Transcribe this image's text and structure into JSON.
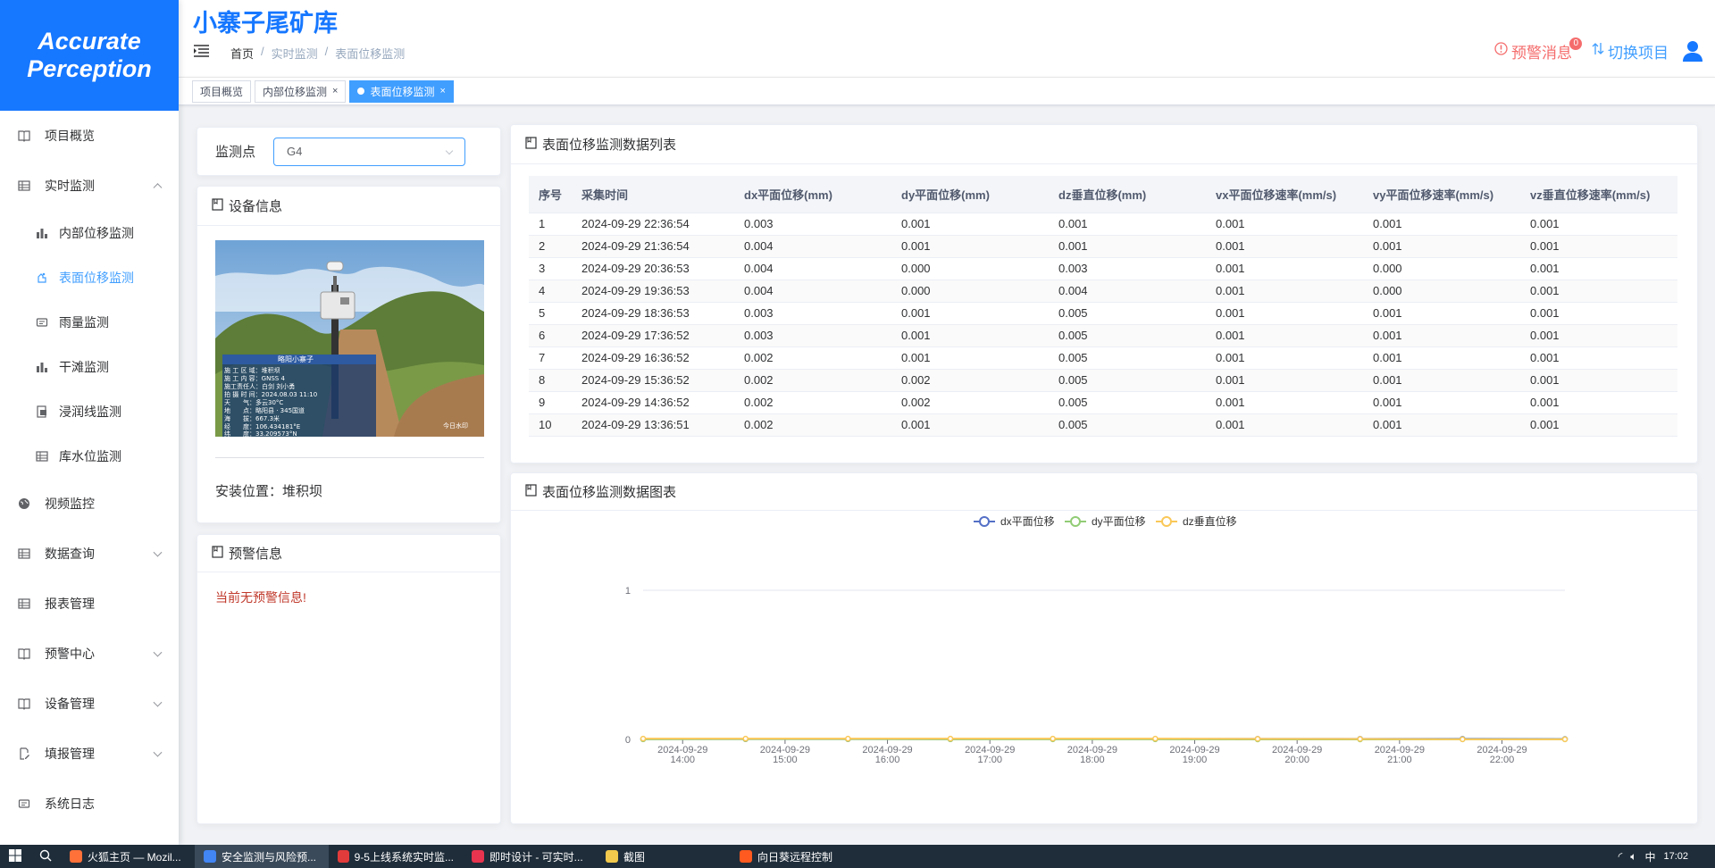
{
  "logo": {
    "line1": "Accurate",
    "line2": "Perception"
  },
  "header": {
    "project_title": "小寨子尾矿库",
    "breadcrumb": [
      "首页",
      "实时监测",
      "表面位移监测"
    ],
    "warning_label": "预警消息",
    "warning_count": "0",
    "switch_label": "切换项目"
  },
  "sidebar": {
    "items": [
      {
        "label": "项目概览",
        "icon": "book-icon"
      },
      {
        "label": "实时监测",
        "icon": "grid-icon"
      },
      {
        "label": "视频监控",
        "icon": "globe-icon"
      },
      {
        "label": "数据查询",
        "icon": "grid-icon"
      },
      {
        "label": "报表管理",
        "icon": "grid-icon"
      },
      {
        "label": "预警中心",
        "icon": "book-icon"
      },
      {
        "label": "设备管理",
        "icon": "book-icon"
      },
      {
        "label": "填报管理",
        "icon": "form-icon"
      },
      {
        "label": "系统日志",
        "icon": "log-icon"
      }
    ],
    "sub_items": [
      {
        "label": "内部位移监测",
        "icon": "bar-chart-icon"
      },
      {
        "label": "表面位移监测",
        "icon": "surface-icon"
      },
      {
        "label": "雨量监测",
        "icon": "rain-icon"
      },
      {
        "label": "干滩监测",
        "icon": "bar-chart-icon"
      },
      {
        "label": "浸润线监测",
        "icon": "doc-icon"
      },
      {
        "label": "库水位监测",
        "icon": "grid-icon"
      }
    ]
  },
  "tags": [
    {
      "label": "项目概览",
      "closable": false
    },
    {
      "label": "内部位移监测",
      "closable": true
    },
    {
      "label": "表面位移监测",
      "closable": true,
      "active": true
    }
  ],
  "monitor": {
    "label": "监测点",
    "selected": "G4"
  },
  "device": {
    "title": "设备信息",
    "install_label": "安装位置：",
    "install_value": "堆积坝",
    "photo_overlay": {
      "header": "略阳小寨子",
      "lines": [
        "施 工 区 域：堆积坝",
        "施 工 内 容：GNSS 4",
        "施工责任人：白剑 刘小勇",
        "拍 摄 时 间：2024.08.03 11:10",
        "天　　气：多云30°C",
        "地　　点：略阳县 · 345国道",
        "海　　拔：667.3米",
        "经　　度：106.434181°E",
        "纬　　度：33.209573°N"
      ],
      "watermark": "今日水印"
    }
  },
  "warning_info": {
    "title": "预警信息",
    "message": "当前无预警信息!"
  },
  "table": {
    "title": "表面位移监测数据列表",
    "columns": [
      "序号",
      "采集时间",
      "dx平面位移(mm)",
      "dy平面位移(mm)",
      "dz垂直位移(mm)",
      "vx平面位移速率(mm/s)",
      "vy平面位移速率(mm/s)",
      "vz垂直位移速率(mm/s)"
    ],
    "rows": [
      [
        "1",
        "2024-09-29 22:36:54",
        "0.003",
        "0.001",
        "0.001",
        "0.001",
        "0.001",
        "0.001"
      ],
      [
        "2",
        "2024-09-29 21:36:54",
        "0.004",
        "0.001",
        "0.001",
        "0.001",
        "0.001",
        "0.001"
      ],
      [
        "3",
        "2024-09-29 20:36:53",
        "0.004",
        "0.000",
        "0.003",
        "0.001",
        "0.000",
        "0.001"
      ],
      [
        "4",
        "2024-09-29 19:36:53",
        "0.004",
        "0.000",
        "0.004",
        "0.001",
        "0.000",
        "0.001"
      ],
      [
        "5",
        "2024-09-29 18:36:53",
        "0.003",
        "0.001",
        "0.005",
        "0.001",
        "0.001",
        "0.001"
      ],
      [
        "6",
        "2024-09-29 17:36:52",
        "0.003",
        "0.001",
        "0.005",
        "0.001",
        "0.001",
        "0.001"
      ],
      [
        "7",
        "2024-09-29 16:36:52",
        "0.002",
        "0.001",
        "0.005",
        "0.001",
        "0.001",
        "0.001"
      ],
      [
        "8",
        "2024-09-29 15:36:52",
        "0.002",
        "0.002",
        "0.005",
        "0.001",
        "0.001",
        "0.001"
      ],
      [
        "9",
        "2024-09-29 14:36:52",
        "0.002",
        "0.002",
        "0.005",
        "0.001",
        "0.001",
        "0.001"
      ],
      [
        "10",
        "2024-09-29 13:36:51",
        "0.002",
        "0.001",
        "0.005",
        "0.001",
        "0.001",
        "0.001"
      ]
    ]
  },
  "chart_title": "表面位移监测数据图表",
  "chart_data": {
    "type": "line",
    "x": [
      "2024-09-29 13:36:51",
      "2024-09-29 14:36:52",
      "2024-09-29 15:36:52",
      "2024-09-29 16:36:52",
      "2024-09-29 17:36:52",
      "2024-09-29 18:36:53",
      "2024-09-29 19:36:53",
      "2024-09-29 20:36:53",
      "2024-09-29 21:36:54",
      "2024-09-29 22:36:54"
    ],
    "x_ticks": [
      {
        "t": "2024-09-29 14:00",
        "l1": "2024-09-29",
        "l2": "14:00"
      },
      {
        "t": "2024-09-29 15:00",
        "l1": "2024-09-29",
        "l2": "15:00"
      },
      {
        "t": "2024-09-29 16:00",
        "l1": "2024-09-29",
        "l2": "16:00"
      },
      {
        "t": "2024-09-29 17:00",
        "l1": "2024-09-29",
        "l2": "17:00"
      },
      {
        "t": "2024-09-29 18:00",
        "l1": "2024-09-29",
        "l2": "18:00"
      },
      {
        "t": "2024-09-29 19:00",
        "l1": "2024-09-29",
        "l2": "19:00"
      },
      {
        "t": "2024-09-29 20:00",
        "l1": "2024-09-29",
        "l2": "20:00"
      },
      {
        "t": "2024-09-29 21:00",
        "l1": "2024-09-29",
        "l2": "21:00"
      },
      {
        "t": "2024-09-29 22:00",
        "l1": "2024-09-29",
        "l2": "22:00"
      }
    ],
    "series": [
      {
        "name": "dx平面位移",
        "color": "#5470c6",
        "values": [
          0.002,
          0.002,
          0.002,
          0.002,
          0.003,
          0.003,
          0.004,
          0.004,
          0.004,
          0.003
        ]
      },
      {
        "name": "dy平面位移",
        "color": "#91cc75",
        "values": [
          0.001,
          0.002,
          0.002,
          0.001,
          0.001,
          0.001,
          0.0,
          0.0,
          0.001,
          0.001
        ]
      },
      {
        "name": "dz垂直位移",
        "color": "#fac858",
        "values": [
          0.005,
          0.005,
          0.005,
          0.005,
          0.005,
          0.005,
          0.004,
          0.003,
          0.001,
          0.001
        ]
      }
    ],
    "ylim": [
      0,
      1
    ],
    "yticks": [
      "0",
      "1"
    ],
    "legend": "top-center",
    "grid": true
  },
  "taskbar": {
    "items": [
      {
        "label": "火狐主页 — Mozil...",
        "color": "#ff7139"
      },
      {
        "label": "安全监测与风险预...",
        "color": "#4285f4",
        "active": true
      },
      {
        "label": "9-5上线系统实时监...",
        "color": "#e23b3b"
      },
      {
        "label": "即时设计 - 可实时...",
        "color": "#e8344e"
      },
      {
        "label": "截图",
        "color": "#f2c94c"
      },
      {
        "label": "向日葵远程控制",
        "color": "#ff5a1f"
      }
    ],
    "tray": [
      "中"
    ],
    "time": "17:02"
  }
}
